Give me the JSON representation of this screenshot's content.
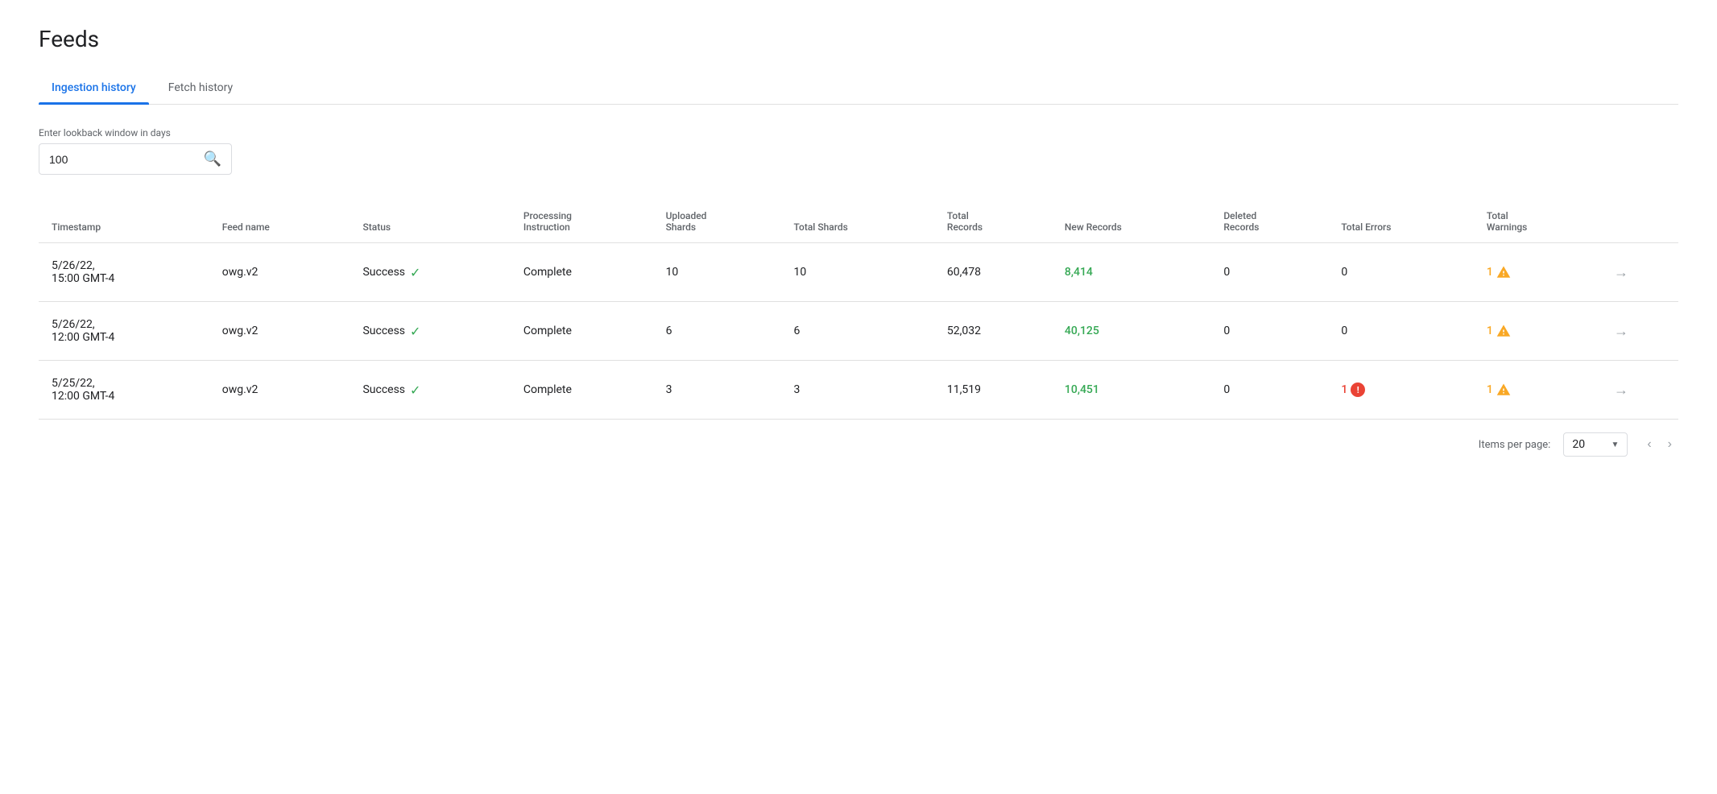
{
  "page": {
    "title": "Feeds"
  },
  "tabs": [
    {
      "id": "ingestion",
      "label": "Ingestion history",
      "active": true
    },
    {
      "id": "fetch",
      "label": "Fetch history",
      "active": false
    }
  ],
  "search": {
    "label": "Enter lookback window in days",
    "value": "100",
    "placeholder": ""
  },
  "table": {
    "columns": [
      {
        "id": "timestamp",
        "label": "Timestamp"
      },
      {
        "id": "feed_name",
        "label": "Feed name"
      },
      {
        "id": "status",
        "label": "Status"
      },
      {
        "id": "processing_instruction",
        "label": "Processing\nInstruction"
      },
      {
        "id": "uploaded_shards",
        "label": "Uploaded\nShards"
      },
      {
        "id": "total_shards",
        "label": "Total Shards"
      },
      {
        "id": "total_records",
        "label": "Total\nRecords"
      },
      {
        "id": "new_records",
        "label": "New Records"
      },
      {
        "id": "deleted_records",
        "label": "Deleted\nRecords"
      },
      {
        "id": "total_errors",
        "label": "Total Errors"
      },
      {
        "id": "total_warnings",
        "label": "Total\nWarnings"
      },
      {
        "id": "nav",
        "label": ""
      }
    ],
    "rows": [
      {
        "timestamp": "5/26/22,\n15:00 GMT-4",
        "feed_name": "owg.v2",
        "status": "Success",
        "processing_instruction": "Complete",
        "uploaded_shards": "10",
        "total_shards": "10",
        "total_records": "60,478",
        "new_records": "8,414",
        "deleted_records": "0",
        "total_errors": "0",
        "total_warnings": "1",
        "has_warning": true,
        "has_error": false,
        "error_count": ""
      },
      {
        "timestamp": "5/26/22,\n12:00 GMT-4",
        "feed_name": "owg.v2",
        "status": "Success",
        "processing_instruction": "Complete",
        "uploaded_shards": "6",
        "total_shards": "6",
        "total_records": "52,032",
        "new_records": "40,125",
        "deleted_records": "0",
        "total_errors": "0",
        "total_warnings": "1",
        "has_warning": true,
        "has_error": false,
        "error_count": ""
      },
      {
        "timestamp": "5/25/22,\n12:00 GMT-4",
        "feed_name": "owg.v2",
        "status": "Success",
        "processing_instruction": "Complete",
        "uploaded_shards": "3",
        "total_shards": "3",
        "total_records": "11,519",
        "new_records": "10,451",
        "deleted_records": "0",
        "total_errors": "1",
        "total_warnings": "1",
        "has_warning": true,
        "has_error": true,
        "error_count": "1"
      }
    ]
  },
  "pagination": {
    "items_per_page_label": "Items per page:",
    "items_per_page_value": "20"
  },
  "icons": {
    "search": "🔍",
    "check": "✓",
    "warning_triangle": "⚠",
    "arrow_right": "→",
    "chevron_left": "‹",
    "chevron_right": "›",
    "chevron_down": "▼"
  }
}
